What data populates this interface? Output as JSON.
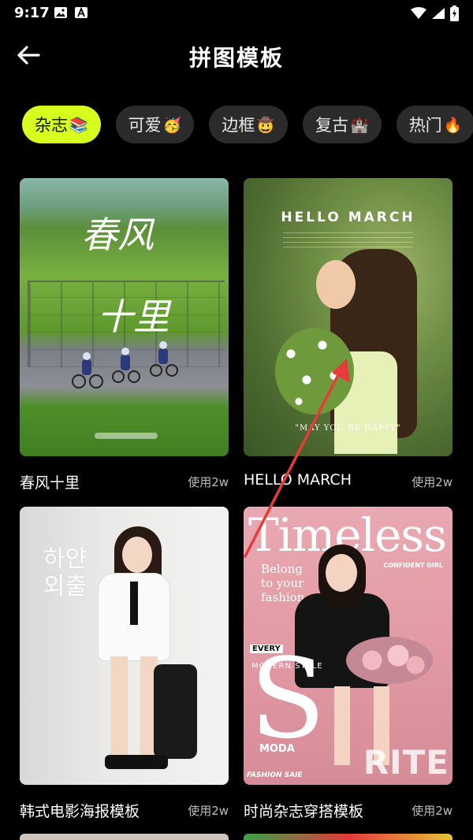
{
  "status_bar": {
    "time": "9:17",
    "icons": [
      "image-icon",
      "a-icon",
      "wifi-icon",
      "signal-icon",
      "battery-icon"
    ]
  },
  "header": {
    "back_icon": "arrow-left-icon",
    "title": "拼图模板"
  },
  "categories": [
    {
      "label": "杂志",
      "emoji": "📚",
      "active": true
    },
    {
      "label": "可爱",
      "emoji": "🥳",
      "active": false
    },
    {
      "label": "边框",
      "emoji": "🤠",
      "active": false
    },
    {
      "label": "复古",
      "emoji": "🏰",
      "active": false
    },
    {
      "label": "热门",
      "emoji": "🔥",
      "active": false
    }
  ],
  "templates": [
    {
      "title": "春风十里",
      "uses": "使用2w",
      "poster_text": {
        "line1": "春风",
        "line2": "十里"
      }
    },
    {
      "title": "HELLO MARCH",
      "uses": "使用2w",
      "poster_text": {
        "headline": "HELLO MARCH",
        "tagline": "\"MAY YOU BE HAPPY\""
      }
    },
    {
      "title": "韩式电影海报模板",
      "uses": "使用2w",
      "poster_text": {
        "vertical": "하얀 외출"
      }
    },
    {
      "title": "时尚杂志穿搭模板",
      "uses": "使用2w",
      "poster_text": {
        "headline": "Timeless",
        "sub": "Belong to your fashion",
        "every": "EVERY",
        "modern": "MODERN STYLE",
        "moda": "MODA",
        "rite": "RITE",
        "saie": "FASHION SAIE",
        "confident": "CONFIDENT GIRL"
      }
    }
  ],
  "colors": {
    "accent": "#d6ff1f",
    "chip_bg": "#2b2b2b",
    "annotation_arrow": "#e83a3a"
  }
}
